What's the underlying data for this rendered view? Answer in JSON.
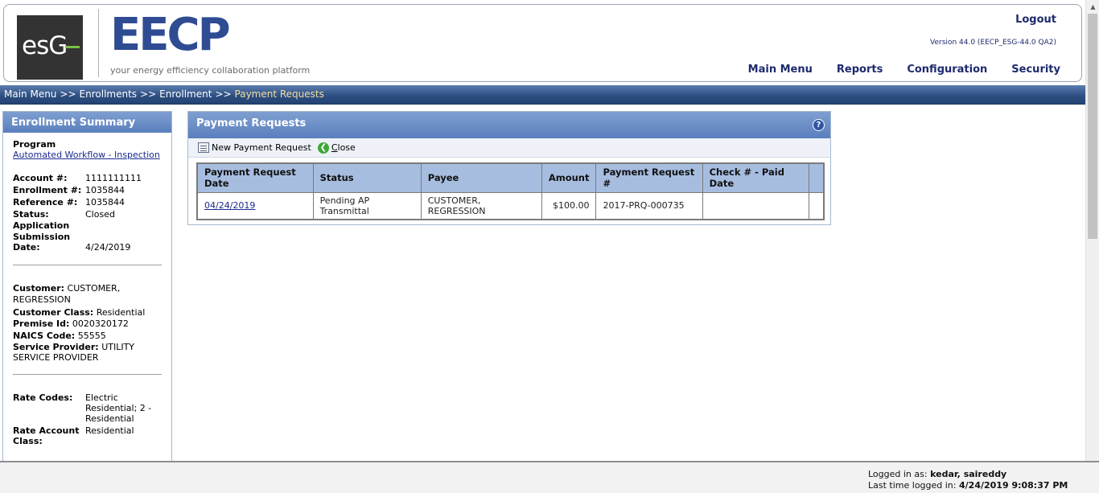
{
  "header": {
    "esg_logo_text": "esG",
    "eecp_logo_text": "EECP",
    "tagline": "your energy efficiency collaboration platform",
    "logout": "Logout",
    "version": "Version 44.0 (EECP_ESG-44.0 QA2)",
    "nav": [
      "Main Menu",
      "Reports",
      "Configuration",
      "Security"
    ]
  },
  "breadcrumb": {
    "items": [
      "Main Menu",
      "Enrollments",
      "Enrollment"
    ],
    "separator": ">>",
    "current": "Payment Requests"
  },
  "sidebar": {
    "title": "Enrollment Summary",
    "program_label": "Program",
    "program_value": "Automated Workflow - Inspection",
    "account_label": "Account #:",
    "account_value": "1111111111",
    "enrollment_label": "Enrollment #:",
    "enrollment_value": "1035844",
    "reference_label": "Reference #:",
    "reference_value": "1035844",
    "status_label": "Status:",
    "status_value": "Closed",
    "app_date_label": "Application Submission Date:",
    "app_date_value": "4/24/2019",
    "customer_label": "Customer:",
    "customer_value": "CUSTOMER, REGRESSION",
    "customer_class_label": "Customer Class:",
    "customer_class_value": "Residential",
    "premise_label": "Premise Id:",
    "premise_value": "0020320172",
    "naics_label": "NAICS Code:",
    "naics_value": "55555",
    "provider_label": "Service Provider:",
    "provider_value": "UTILITY SERVICE PROVIDER",
    "rate_codes_label": "Rate Codes:",
    "rate_codes_value": "Electric Residential; 2 - Residential",
    "rate_account_label": "Rate Account Class:",
    "rate_account_value": "Residential"
  },
  "panel": {
    "title": "Payment Requests",
    "help": "?",
    "toolbar": {
      "new_label": "New Payment Request",
      "close_label": "Close"
    },
    "columns": [
      "Payment Request Date",
      "Status",
      "Payee",
      "Amount",
      "Payment Request #",
      "Check # - Paid Date",
      ""
    ],
    "rows": [
      {
        "date": "04/24/2019",
        "status": "Pending AP Transmittal",
        "payee": "CUSTOMER, REGRESSION",
        "amount": "$100.00",
        "request_no": "2017-PRQ-000735",
        "check_paid": ""
      }
    ]
  },
  "footer": {
    "logged_in_label": "Logged in as:",
    "logged_in_value": "kedar, saireddy",
    "last_time_label": "Last time logged in:",
    "last_time_value": "4/24/2019 9:08:37 PM"
  },
  "colors": {
    "brand_navy": "#2f4c93",
    "header_blue": "#5a7fbd",
    "table_header": "#a7bde0",
    "accent_green": "#7ac143"
  }
}
